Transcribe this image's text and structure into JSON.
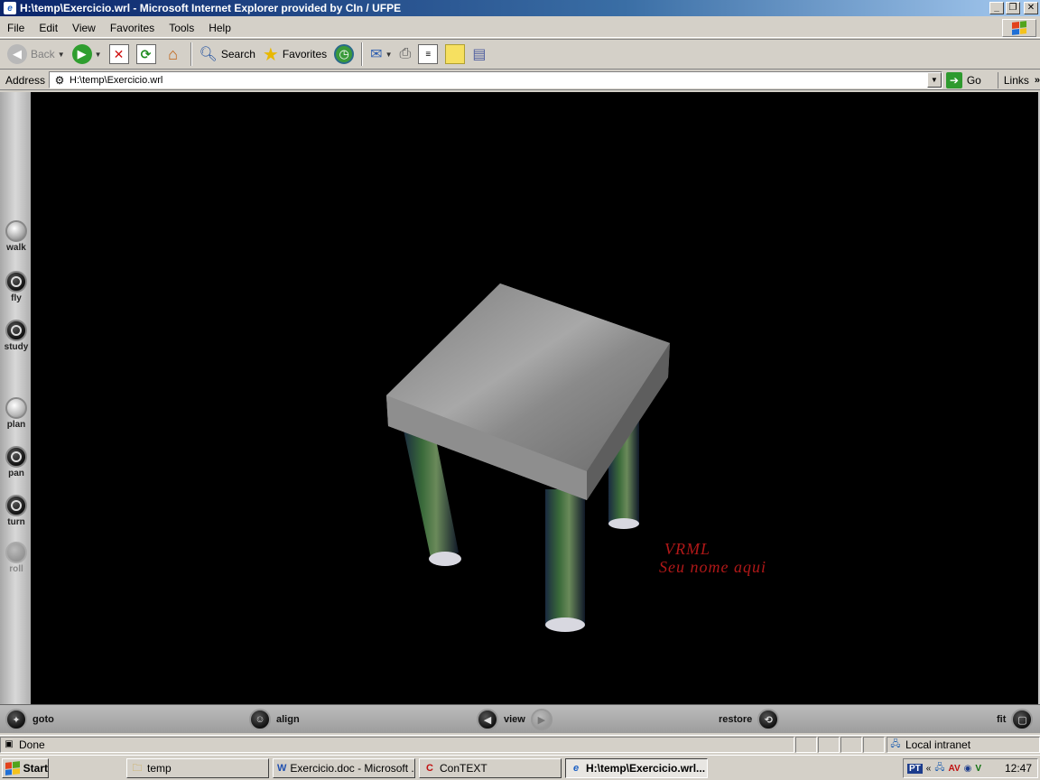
{
  "window": {
    "title": "H:\\temp\\Exercicio.wrl - Microsoft Internet Explorer provided by CIn / UFPE"
  },
  "menu": [
    "File",
    "Edit",
    "View",
    "Favorites",
    "Tools",
    "Help"
  ],
  "toolbar": {
    "back_label": "Back",
    "search_label": "Search",
    "favorites_label": "Favorites"
  },
  "address": {
    "label": "Address",
    "value": "H:\\temp\\Exercicio.wrl",
    "go_label": "Go",
    "links_label": "Links"
  },
  "viewer": {
    "nav_left": [
      "walk",
      "fly",
      "study",
      "plan",
      "pan",
      "turn",
      "roll"
    ],
    "bottom": {
      "goto": "goto",
      "align": "align",
      "view": "view",
      "restore": "restore",
      "fit": "fit"
    },
    "scene_text": {
      "line1": "VRML",
      "line2": "Seu nome aqui",
      "color": "#b01818"
    }
  },
  "status": {
    "text": "Done",
    "zone": "Local intranet"
  },
  "taskbar": {
    "start_label": "Start",
    "tasks": [
      "temp",
      "Exercicio.doc - Microsoft ...",
      "ConTEXT",
      "H:\\temp\\Exercicio.wrl..."
    ],
    "lang": "PT",
    "clock": "12:47"
  }
}
